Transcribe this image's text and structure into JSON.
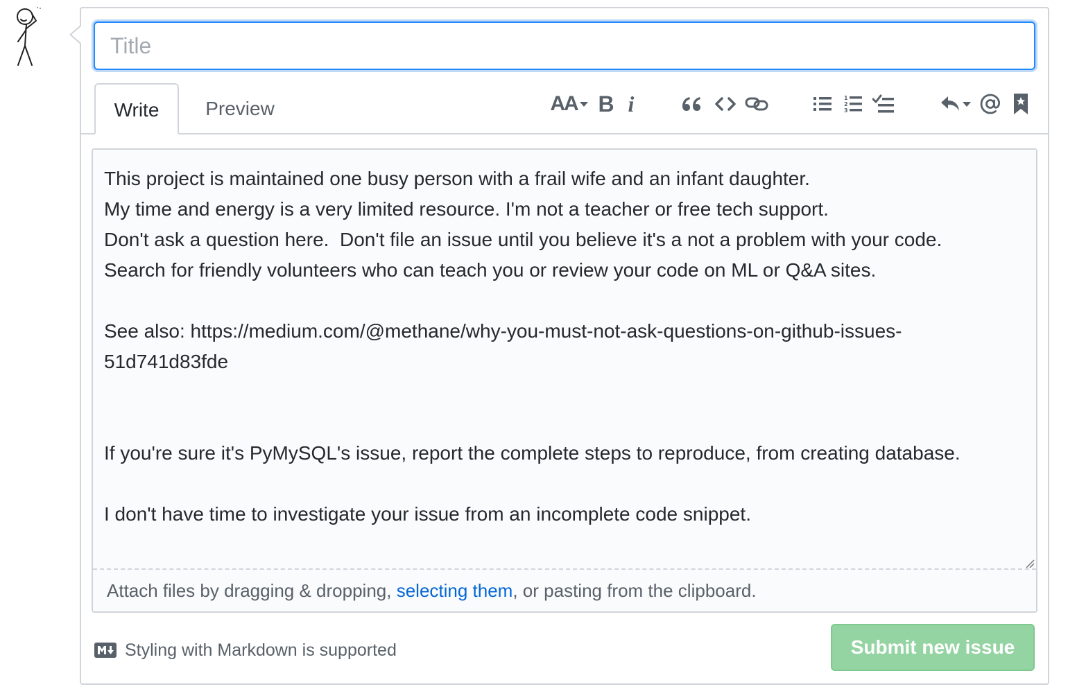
{
  "title_field": {
    "placeholder": "Title",
    "value": ""
  },
  "tabs": [
    {
      "label": "Write",
      "active": true
    },
    {
      "label": "Preview",
      "active": false
    }
  ],
  "toolbar": {
    "header_label": "AA",
    "bold_label": "B",
    "italic_label": "i",
    "icons": [
      "header-icon",
      "bold-icon",
      "italic-icon",
      "quote-icon",
      "code-icon",
      "link-icon",
      "unordered-list-icon",
      "ordered-list-icon",
      "task-list-icon",
      "reply-icon",
      "mention-icon",
      "bookmark-icon"
    ]
  },
  "body": {
    "text": "This project is maintained one busy person with a frail wife and an infant daughter.\nMy time and energy is a very limited resource. I'm not a teacher or free tech support.\nDon't ask a question here.  Don't file an issue until you believe it's a not a problem with your code.\nSearch for friendly volunteers who can teach you or review your code on ML or Q&A sites.\n\nSee also: https://medium.com/@methane/why-you-must-not-ask-questions-on-github-issues-51d741d83fde\n\n\nIf you're sure it's PyMySQL's issue, report the complete steps to reproduce, from creating database.\n\nI don't have time to investigate your issue from an incomplete code snippet."
  },
  "attach": {
    "prefix": "Attach files by dragging & dropping, ",
    "link": "selecting them",
    "suffix": ", or pasting from the clipboard."
  },
  "markdown_note": "Styling with Markdown is supported",
  "submit_label": "Submit new issue",
  "colors": {
    "accent": "#0366d6",
    "focus": "#2188ff",
    "submit_disabled": "#94d3a2",
    "border": "#d1d5da"
  }
}
